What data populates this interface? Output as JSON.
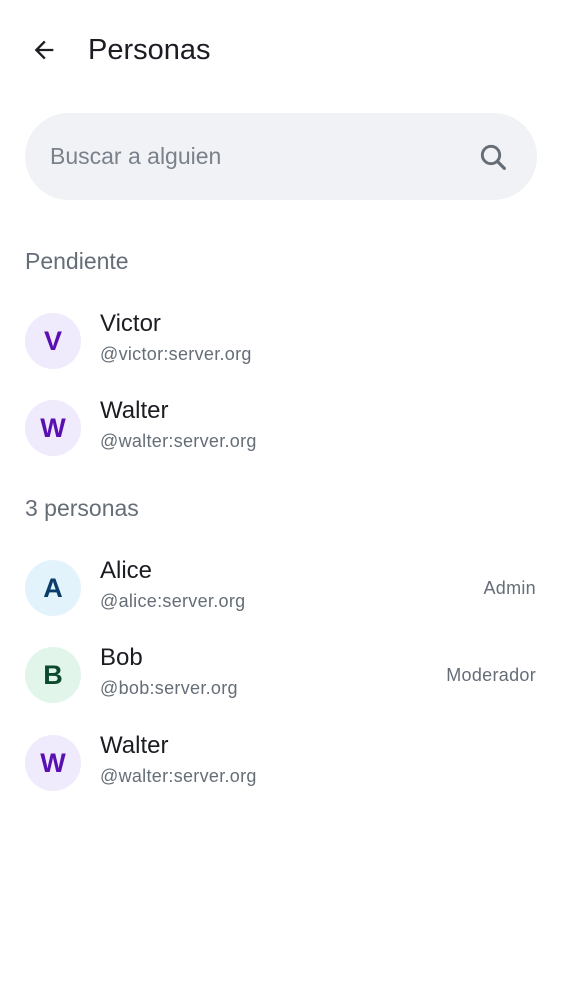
{
  "header": {
    "title": "Personas",
    "back_icon": "arrow-left-icon"
  },
  "search": {
    "placeholder": "Buscar a alguien",
    "value": "",
    "icon": "search-icon"
  },
  "pending": {
    "label": "Pendiente",
    "members": [
      {
        "initial": "V",
        "name": "Victor",
        "handle": "@victor:server.org",
        "avatar_bg": "#efeafc",
        "avatar_fg": "#5a0fb0"
      },
      {
        "initial": "W",
        "name": "Walter",
        "handle": "@walter:server.org",
        "avatar_bg": "#efeafc",
        "avatar_fg": "#5a0fb0"
      }
    ]
  },
  "joined": {
    "label": "3 personas",
    "members": [
      {
        "initial": "A",
        "name": "Alice",
        "handle": "@alice:server.org",
        "role": "Admin",
        "avatar_bg": "#e3f3fb",
        "avatar_fg": "#0a3d6b"
      },
      {
        "initial": "B",
        "name": "Bob",
        "handle": "@bob:server.org",
        "role": "Moderador",
        "avatar_bg": "#e1f5ea",
        "avatar_fg": "#0c4a2e"
      },
      {
        "initial": "W",
        "name": "Walter",
        "handle": "@walter:server.org",
        "role": "",
        "avatar_bg": "#efeafc",
        "avatar_fg": "#5a0fb0"
      }
    ]
  }
}
